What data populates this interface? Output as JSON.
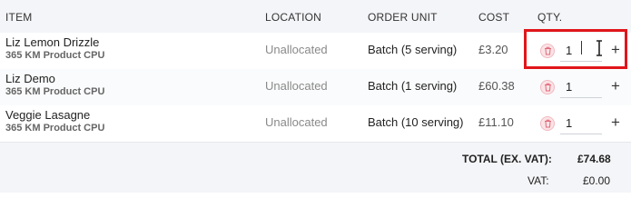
{
  "table": {
    "headers": {
      "item": "ITEM",
      "location": "LOCATION",
      "order_unit": "ORDER UNIT",
      "cost": "COST",
      "qty": "QTY."
    },
    "rows": [
      {
        "name": "Liz Lemon Drizzle",
        "sub": "365 KM Product CPU",
        "location": "Unallocated",
        "order_unit": "Batch (5 serving)",
        "cost": "£3.20",
        "qty": "1"
      },
      {
        "name": "Liz Demo",
        "sub": "365 KM Product CPU",
        "location": "Unallocated",
        "order_unit": "Batch (1 serving)",
        "cost": "£60.38",
        "qty": "1"
      },
      {
        "name": "Veggie Lasagne",
        "sub": "365 KM Product CPU",
        "location": "Unallocated",
        "order_unit": "Batch (10 serving)",
        "cost": "£11.10",
        "qty": "1"
      }
    ],
    "plus_glyph": "+"
  },
  "totals": {
    "total_label": "TOTAL (EX. VAT):",
    "total_value": "£74.68",
    "vat_label": "VAT:",
    "vat_value": "£0.00"
  },
  "icons": {
    "delete": "trash-icon",
    "increment": "plus-icon",
    "cursor": "text-cursor-icon"
  },
  "colors": {
    "highlight": "#e0161b",
    "delete_bg": "#fbe3e6",
    "delete_fg": "#e06a7a"
  }
}
